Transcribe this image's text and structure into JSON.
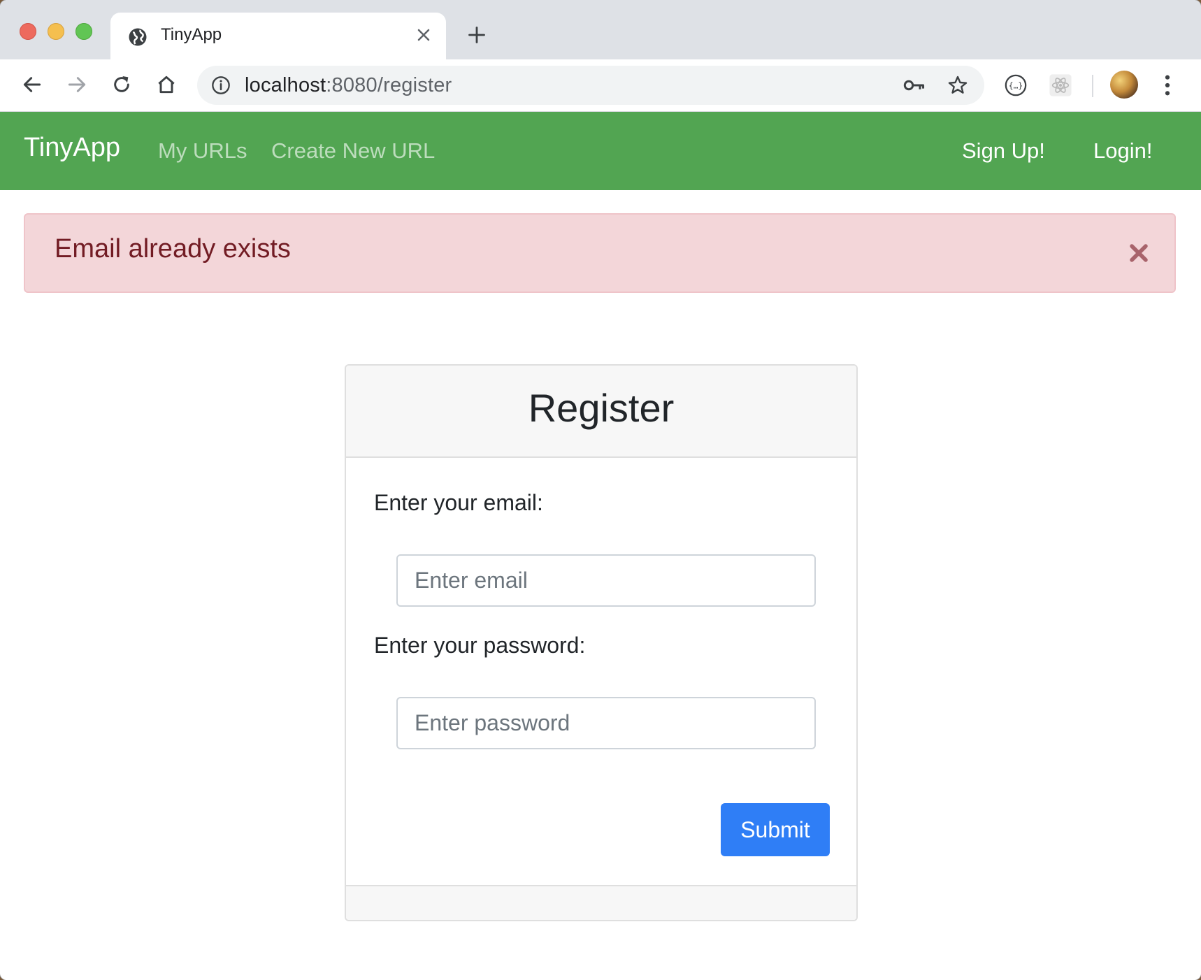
{
  "browser": {
    "tab": {
      "title": "TinyApp"
    },
    "url": {
      "host": "localhost",
      "rest": ":8080/register"
    }
  },
  "navbar": {
    "brand": "TinyApp",
    "links": [
      "My URLs",
      "Create New URL"
    ],
    "right": [
      "Sign Up!",
      "Login!"
    ]
  },
  "alert": {
    "message": "Email already exists",
    "close_glyph": "×"
  },
  "form": {
    "title": "Register",
    "email_label": "Enter your email:",
    "email_placeholder": "Enter email",
    "password_label": "Enter your password:",
    "password_placeholder": "Enter password",
    "submit_label": "Submit"
  },
  "colors": {
    "navbar": "#52a552",
    "alert_bg": "#f3d6d9",
    "alert_text": "#721c24",
    "button": "#2f7ef6"
  }
}
